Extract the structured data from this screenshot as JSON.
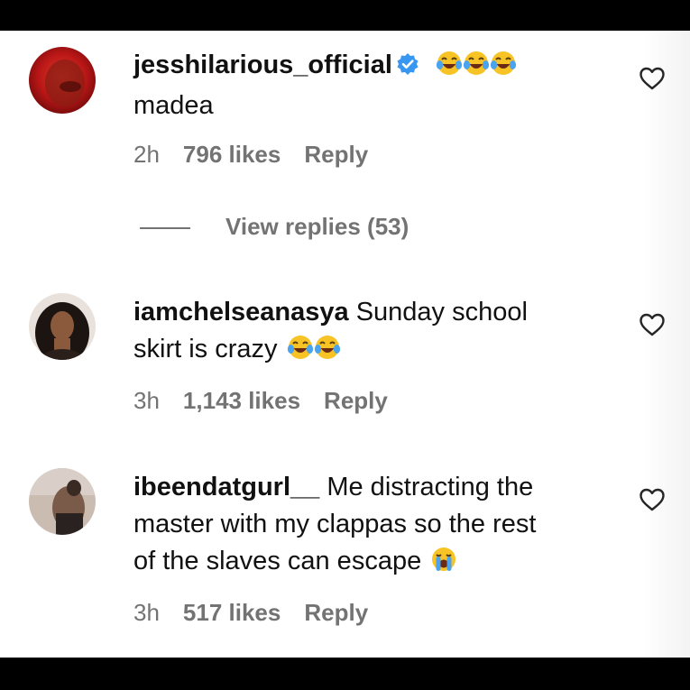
{
  "comments": [
    {
      "username": "jesshilarious_official",
      "verified": true,
      "text": "madea",
      "emoji_before_text": [
        "face-with-tears-of-joy",
        "face-with-tears-of-joy",
        "face-with-tears-of-joy"
      ],
      "time": "2h",
      "likes": "796 likes",
      "reply": "Reply",
      "view_replies": "View replies (53)"
    },
    {
      "username": "iamchelseanasya",
      "verified": false,
      "text_line1": "Sunday school",
      "text_line2": "skirt is crazy",
      "emoji_after_text": [
        "face-with-tears-of-joy",
        "face-with-tears-of-joy"
      ],
      "time": "3h",
      "likes": "1,143 likes",
      "reply": "Reply"
    },
    {
      "username": "ibeendatgurl__",
      "verified": false,
      "text_line1": "Me distracting the",
      "text_line2": "master with my clappas so the rest",
      "text_line3": "of the slaves can escape",
      "emoji_after_text": [
        "loudly-crying-face"
      ],
      "time": "3h",
      "likes": "517 likes",
      "reply": "Reply"
    }
  ],
  "icons": {
    "like": "heart-outline-icon",
    "verified": "verified-badge-icon"
  },
  "colors": {
    "text": "#111111",
    "meta": "#737373",
    "verified_blue": "#3897f0",
    "background": "#ffffff",
    "letterbox": "#000000"
  }
}
